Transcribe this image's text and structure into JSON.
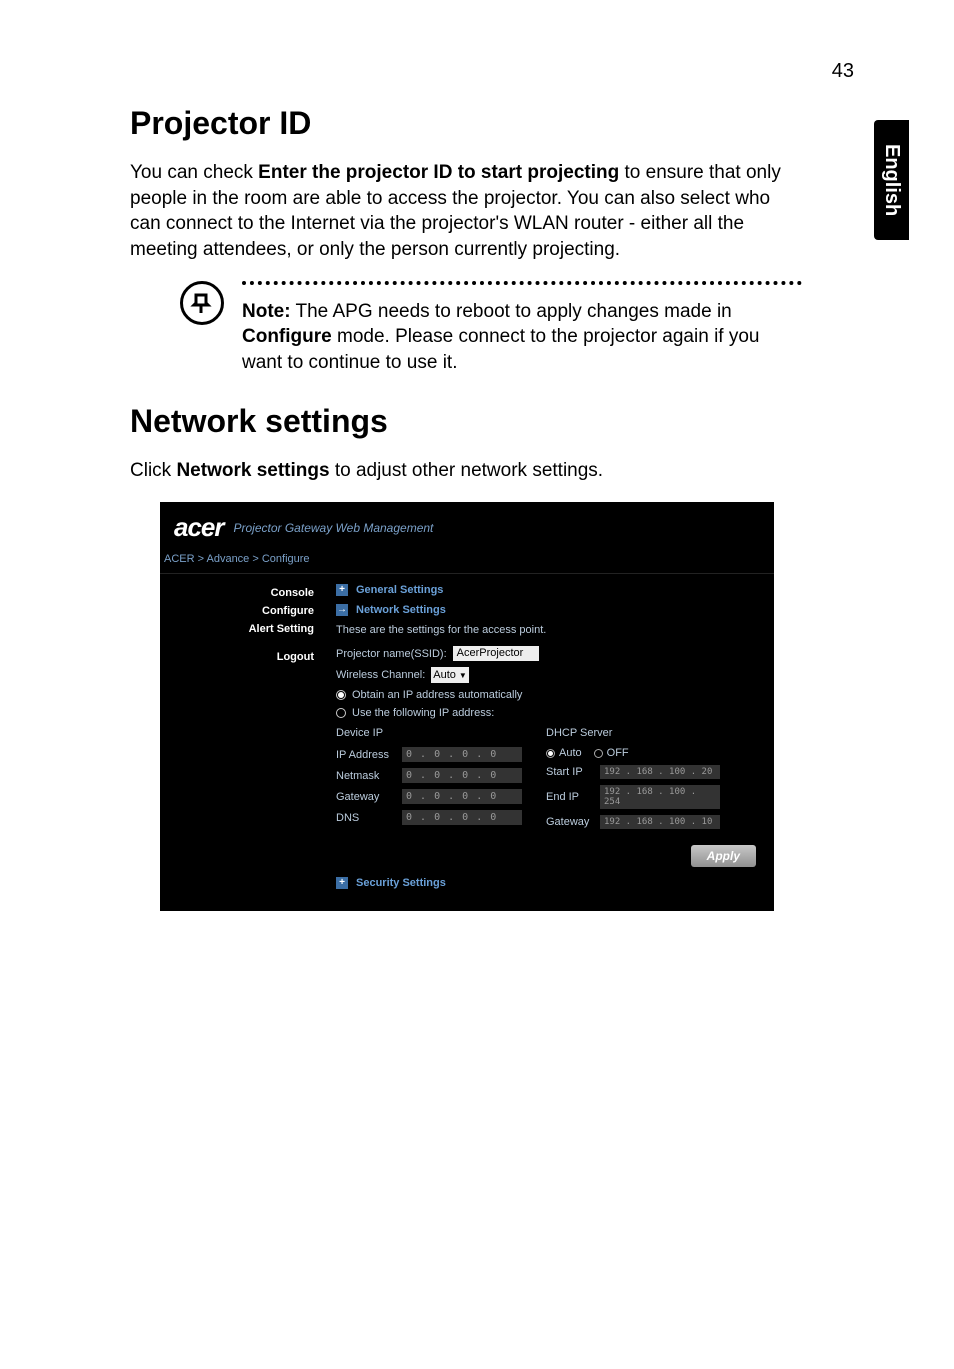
{
  "page_number": "43",
  "side_tab": "English",
  "section1": {
    "title": "Projector ID",
    "body_pre": "You can check ",
    "body_bold": "Enter the projector ID to start projecting",
    "body_post": " to ensure that only people in the room are able to access the projector. You can also select who can connect to the Internet via the projector's WLAN router - either all the meeting attendees, or only the person currently projecting."
  },
  "note": {
    "label": "Note:",
    "text_a": " The APG needs to reboot to apply changes made in ",
    "text_bold": "Configure",
    "text_b": " mode. Please connect to the projector again if you want to continue to use it."
  },
  "section2": {
    "title": "Network settings",
    "intro_pre": "Click ",
    "intro_bold": "Network settings",
    "intro_post": " to adjust other network settings."
  },
  "shot": {
    "brand": "acer",
    "subtitle": "Projector Gateway Web Management",
    "breadcrumb": "ACER > Advance > Configure",
    "nav": {
      "console": "Console",
      "configure": "Configure",
      "alert": "Alert Setting",
      "logout": "Logout"
    },
    "sections": {
      "general": "General Settings",
      "network": "Network Settings",
      "security": "Security Settings"
    },
    "desc": "These are the settings for the access point.",
    "ssid_label": "Projector name(SSID):",
    "ssid_value": "AcerProjector",
    "channel_label": "Wireless Channel:",
    "channel_value": "Auto",
    "ip_auto": "Obtain an IP address automatically",
    "ip_manual": "Use the following IP address:",
    "device_ip_head": "Device IP",
    "dhcp_head": "DHCP Server",
    "labels": {
      "ip": "IP Address",
      "netmask": "Netmask",
      "gateway": "Gateway",
      "dns": "DNS",
      "auto": "Auto",
      "off": "OFF",
      "startip": "Start IP",
      "endip": "End IP",
      "dgateway": "Gateway"
    },
    "values": {
      "zero": "0 . 0 . 0 . 0",
      "startip": "192 . 168 . 100 . 20",
      "endip": "192 . 168 . 100 . 254",
      "dgateway": "192 . 168 . 100 . 10"
    },
    "apply": "Apply"
  }
}
